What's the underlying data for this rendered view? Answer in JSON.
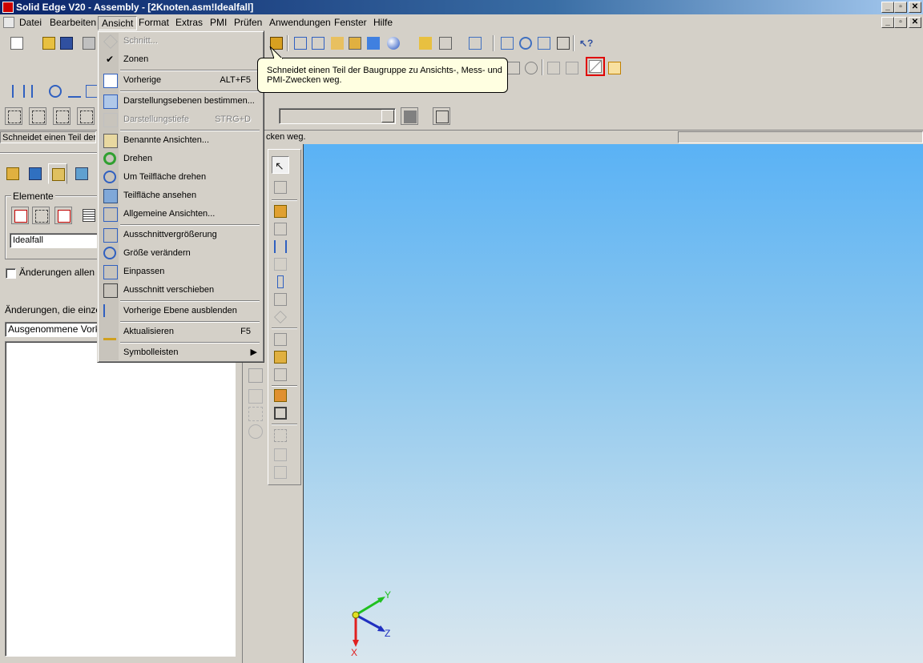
{
  "window": {
    "title": "Solid Edge V20 - Assembly - [2Knoten.asm!Idealfall]"
  },
  "menubar": {
    "items": [
      "Datei",
      "Bearbeiten",
      "Ansicht",
      "Format",
      "Extras",
      "PMI",
      "Prüfen",
      "Anwendungen",
      "Fenster",
      "Hilfe"
    ],
    "active": "Ansicht"
  },
  "ansicht_menu": {
    "items": [
      {
        "label": "Schnitt...",
        "accel": "",
        "disabled": true,
        "icon": "section-icon"
      },
      {
        "label": "Zonen",
        "accel": "",
        "checked": true,
        "icon": "check-icon"
      },
      {
        "label": "Vorherige",
        "accel": "ALT+F5",
        "icon": "previous-view-icon"
      },
      {
        "label": "Darstellungsebenen bestimmen...",
        "accel": "",
        "icon": "display-planes-icon"
      },
      {
        "label": "Darstellungstiefe",
        "accel": "STRG+D",
        "disabled": true,
        "icon": "depth-icon"
      },
      {
        "label": "Benannte Ansichten...",
        "accel": "",
        "icon": "named-views-icon"
      },
      {
        "label": "Drehen",
        "accel": "",
        "icon": "rotate-icon"
      },
      {
        "label": "Um Teilfläche drehen",
        "accel": "",
        "icon": "rotate-face-icon"
      },
      {
        "label": "Teilfläche ansehen",
        "accel": "",
        "icon": "look-at-face-icon"
      },
      {
        "label": "Allgemeine Ansichten...",
        "accel": "",
        "icon": "common-views-icon"
      },
      {
        "label": "Ausschnittvergrößerung",
        "accel": "",
        "icon": "zoom-area-icon"
      },
      {
        "label": "Größe verändern",
        "accel": "",
        "icon": "zoom-icon"
      },
      {
        "label": "Einpassen",
        "accel": "",
        "icon": "fit-icon"
      },
      {
        "label": "Ausschnitt verschieben",
        "accel": "",
        "icon": "pan-icon"
      },
      {
        "label": "Vorherige Ebene ausblenden",
        "accel": "",
        "icon": "hide-level-icon"
      },
      {
        "label": "Aktualisieren",
        "accel": "F5",
        "icon": "refresh-icon"
      },
      {
        "label": "Symbolleisten",
        "accel": "",
        "submenu": true,
        "icon": ""
      }
    ]
  },
  "tooltip": {
    "line1": "Schneidet einen Teil der Baugruppe zu Ansichts-, Mess- und",
    "line2": "PMI-Zwecken weg."
  },
  "status": {
    "left": "Schneidet einen Teil der B",
    "middle": "cken weg."
  },
  "panel": {
    "group_label": "Elemente",
    "config_value": "Idealfall",
    "checkbox_label": "Änderungen allen El",
    "changes_label": "Änderungen, die einzeln",
    "excluded_value": "Ausgenommene Vorkom"
  },
  "triad": {
    "x": "X",
    "y": "Y",
    "z": "Z"
  },
  "colors": {
    "viewport_top": "#5ab2f5",
    "viewport_bottom": "#d9e6ee",
    "tooltip_bg": "#ffffe1",
    "section_tool_highlight": "#e00000"
  }
}
